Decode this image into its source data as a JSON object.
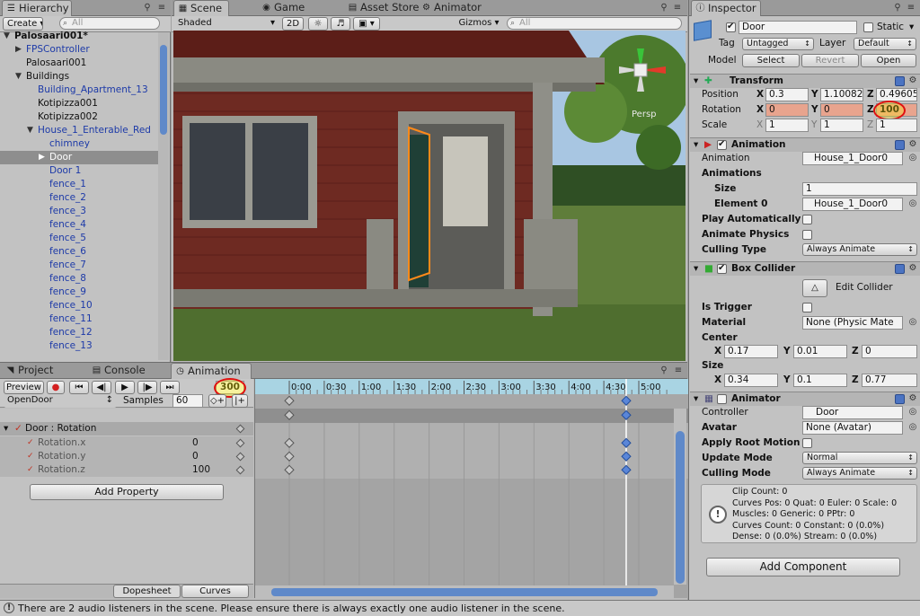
{
  "hierarchy": {
    "tab": "Hierarchy",
    "create_label": "Create",
    "search_placeholder": "All",
    "items": [
      {
        "label": "Palosaari001*",
        "style": "bold",
        "indent": 0,
        "arrow": "open"
      },
      {
        "label": "FPSController",
        "style": "blue",
        "indent": 1,
        "arrow": "closed"
      },
      {
        "label": "Palosaari001",
        "style": "normal",
        "indent": 1,
        "arrow": ""
      },
      {
        "label": "Buildings",
        "style": "normal",
        "indent": 1,
        "arrow": "open"
      },
      {
        "label": "Building_Apartment_13",
        "style": "blue",
        "indent": 2,
        "arrow": ""
      },
      {
        "label": "Kotipizza001",
        "style": "normal",
        "indent": 2,
        "arrow": ""
      },
      {
        "label": "Kotipizza002",
        "style": "normal",
        "indent": 2,
        "arrow": ""
      },
      {
        "label": "House_1_Enterable_Red",
        "style": "blue",
        "indent": 2,
        "arrow": "open"
      },
      {
        "label": "chimney",
        "style": "blue",
        "indent": 3,
        "arrow": ""
      },
      {
        "label": "Door",
        "style": "selected",
        "indent": 3,
        "arrow": "closed"
      },
      {
        "label": "Door 1",
        "style": "blue",
        "indent": 3,
        "arrow": ""
      },
      {
        "label": "fence_1",
        "style": "blue",
        "indent": 3,
        "arrow": ""
      },
      {
        "label": "fence_2",
        "style": "blue",
        "indent": 3,
        "arrow": ""
      },
      {
        "label": "fence_3",
        "style": "blue",
        "indent": 3,
        "arrow": ""
      },
      {
        "label": "fence_4",
        "style": "blue",
        "indent": 3,
        "arrow": ""
      },
      {
        "label": "fence_5",
        "style": "blue",
        "indent": 3,
        "arrow": ""
      },
      {
        "label": "fence_6",
        "style": "blue",
        "indent": 3,
        "arrow": ""
      },
      {
        "label": "fence_7",
        "style": "blue",
        "indent": 3,
        "arrow": ""
      },
      {
        "label": "fence_8",
        "style": "blue",
        "indent": 3,
        "arrow": ""
      },
      {
        "label": "fence_9",
        "style": "blue",
        "indent": 3,
        "arrow": ""
      },
      {
        "label": "fence_10",
        "style": "blue",
        "indent": 3,
        "arrow": ""
      },
      {
        "label": "fence_11",
        "style": "blue",
        "indent": 3,
        "arrow": ""
      },
      {
        "label": "fence_12",
        "style": "blue",
        "indent": 3,
        "arrow": ""
      },
      {
        "label": "fence_13",
        "style": "blue",
        "indent": 3,
        "arrow": ""
      }
    ]
  },
  "scene": {
    "tabs": {
      "scene": "Scene",
      "game": "Game",
      "asset_store": "Asset Store",
      "animator": "Animator"
    },
    "shading": "Shaded",
    "mode_2d": "2D",
    "gizmos": "Gizmos",
    "search_placeholder": "All",
    "persp": "Persp"
  },
  "bottom_tabs": {
    "project": "Project",
    "console": "Console",
    "animation": "Animation"
  },
  "animation": {
    "preview_label": "Preview",
    "frame_value": "300",
    "clip": "OpenDoor",
    "samples_label": "Samples",
    "samples_value": "60",
    "ruler": [
      "0:00",
      "0:30",
      "1:00",
      "1:30",
      "2:00",
      "2:30",
      "3:00",
      "3:30",
      "4:00",
      "4:30",
      "5:00"
    ],
    "property_group": "Door : Rotation",
    "properties": [
      {
        "name": "Rotation.x",
        "value": "0"
      },
      {
        "name": "Rotation.y",
        "value": "0"
      },
      {
        "name": "Rotation.z",
        "value": "100"
      }
    ],
    "add_property": "Add Property",
    "dopesheet": "Dopesheet",
    "curves": "Curves"
  },
  "inspector": {
    "tab": "Inspector",
    "name": "Door",
    "static_label": "Static",
    "tag_label": "Tag",
    "tag_value": "Untagged",
    "layer_label": "Layer",
    "layer_value": "Default",
    "model_label": "Model",
    "select": "Select",
    "revert": "Revert",
    "open": "Open",
    "transform": {
      "title": "Transform",
      "position_label": "Position",
      "rotation_label": "Rotation",
      "scale_label": "Scale",
      "position": {
        "x": "0.3",
        "y": "1.10082",
        "z": "0.49605"
      },
      "rotation": {
        "x": "0",
        "y": "0",
        "z": "100"
      },
      "scale": {
        "x": "1",
        "y": "1",
        "z": "1"
      }
    },
    "animation_comp": {
      "title": "Animation",
      "animation_label": "Animation",
      "animation_value": "House_1_Door0",
      "animations_label": "Animations",
      "size_label": "Size",
      "size_value": "1",
      "element_label": "Element 0",
      "element_value": "House_1_Door0",
      "play_auto": "Play Automatically",
      "animate_physics": "Animate Physics",
      "culling_label": "Culling Type",
      "culling_value": "Always Animate"
    },
    "box_collider": {
      "title": "Box Collider",
      "edit_collider": "Edit Collider",
      "is_trigger": "Is Trigger",
      "material_label": "Material",
      "material_value": "None (Physic Mate",
      "center_label": "Center",
      "center": {
        "x": "0.17",
        "y": "0.01",
        "z": "0"
      },
      "size_label": "Size",
      "size": {
        "x": "0.34",
        "y": "0.1",
        "z": "0.77"
      }
    },
    "animator": {
      "title": "Animator",
      "controller_label": "Controller",
      "controller_value": "Door",
      "avatar_label": "Avatar",
      "avatar_value": "None (Avatar)",
      "root_motion": "Apply Root Motion",
      "update_label": "Update Mode",
      "update_value": "Normal",
      "culling_label": "Culling Mode",
      "culling_value": "Always Animate",
      "info": [
        "Clip Count: 0",
        "Curves Pos: 0 Quat: 0 Euler: 0 Scale: 0",
        "Muscles: 0 Generic: 0 PPtr: 0",
        "Curves Count: 0 Constant: 0 (0.0%)",
        "Dense: 0 (0.0%) Stream: 0 (0.0%)"
      ]
    },
    "add_component": "Add Component"
  },
  "status_bar": "There are 2 audio listeners in the scene. Please ensure there is always exactly one audio listener in the scene.",
  "colors": {
    "accent_blue": "#1d3aa8",
    "selection": "#8e8e8e",
    "rotation_field": "#e8a48e",
    "highlight_circle": "#e01010",
    "timeline_ruler": "#a9d4e3"
  }
}
